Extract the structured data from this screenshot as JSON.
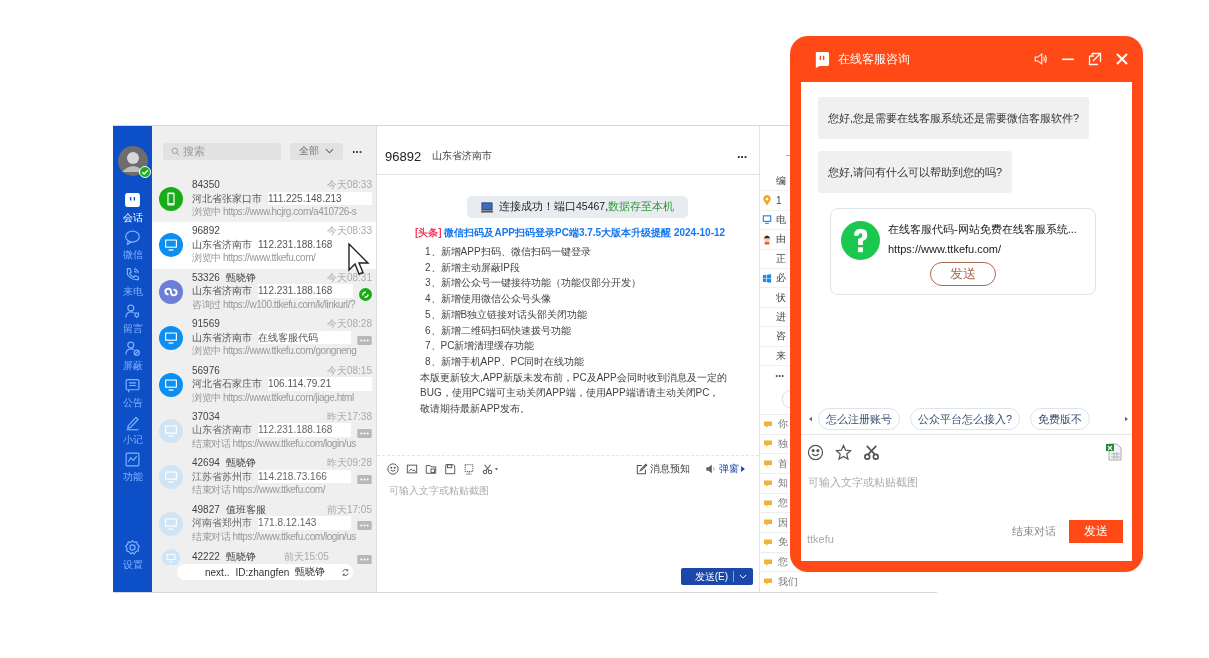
{
  "sidebar": {
    "online": true,
    "nav": [
      {
        "label": "会话",
        "selected": true
      },
      {
        "label": "微信",
        "selected": false
      },
      {
        "label": "来电",
        "selected": false
      },
      {
        "label": "留言",
        "selected": false
      },
      {
        "label": "屏蔽",
        "selected": false
      },
      {
        "label": "公告",
        "selected": false
      },
      {
        "label": "小记",
        "selected": false
      },
      {
        "label": "功能",
        "selected": false
      }
    ],
    "settings": "设置"
  },
  "list": {
    "search": {
      "placeholder": "搜索"
    },
    "filter": "全部",
    "more": "···"
  },
  "conversations": [
    {
      "id": "84350",
      "time": "今天08:33",
      "location": "河北省张家口市",
      "info": "111.225.148.213",
      "detail": "浏览中 https://www.hcjrg.com/a410726-s",
      "kind": "phone",
      "ended": false,
      "selected": false,
      "wechat": false,
      "menu": false
    },
    {
      "id": "96892",
      "time": "今天08:33",
      "location": "山东省济南市",
      "info": "112.231.188.168",
      "detail": "浏览中 https://www.ttkefu.com/",
      "kind": "monitor",
      "ended": false,
      "selected": true,
      "wechat": false,
      "menu": false
    },
    {
      "id": "53326",
      "name": "甄晓铮",
      "time": "今天08:31",
      "location": "山东省济南市",
      "info": "112.231.188.168",
      "detail": "咨询过 https://w100.ttkefu.com/k/linkurl/?",
      "kind": "miniapp",
      "ended": false,
      "selected": false,
      "wechat": true,
      "menu": false
    },
    {
      "id": "91569",
      "time": "今天08:28",
      "location": "山东省济南市",
      "info": "在线客服代码",
      "detail": "浏览中 https://www.ttkefu.com/gongneng",
      "kind": "monitor",
      "ended": false,
      "selected": false,
      "wechat": false,
      "menu": true
    },
    {
      "id": "56976",
      "time": "今天08:15",
      "location": "河北省石家庄市",
      "info": "106.114.79.21",
      "detail": "浏览中 https://www.ttkefu.com/jiage.html",
      "kind": "monitor",
      "ended": false,
      "selected": false,
      "wechat": false,
      "menu": false
    },
    {
      "id": "37034",
      "time": "昨天17:38",
      "location": "山东省济南市",
      "info": "112.231.188.168",
      "detail": "结束对话 https://www.ttkefu.com/login/us",
      "kind": "monitor",
      "ended": true,
      "selected": false,
      "wechat": false,
      "menu": true
    },
    {
      "id": "42694",
      "name": "甄晓铮",
      "time": "昨天09:28",
      "location": "江苏省苏州市",
      "info": "114.218.73.166",
      "detail": "结束对话 https://www.ttkefu.com/",
      "kind": "monitor",
      "ended": true,
      "selected": false,
      "wechat": false,
      "menu": true
    },
    {
      "id": "49827",
      "name": "值班客服",
      "time": "前天17:05",
      "location": "河南省郑州市",
      "info": "171.8.12.143",
      "detail": "结束对话 https://www.ttkefu.com/login/us",
      "kind": "monitor",
      "ended": true,
      "selected": false,
      "wechat": false,
      "menu": true
    },
    {
      "id": "42222",
      "name": "甄晓铮",
      "time": "前天15:05",
      "kind": "monitor",
      "ended": true,
      "selected": false,
      "wechat": false,
      "menu": true
    }
  ],
  "agent_pill": {
    "text": "next..",
    "id": "ID:zhangfen",
    "name": "甄晓铮"
  },
  "chat": {
    "visitor_id": "96892",
    "location": "山东省济南市",
    "more": "···",
    "banner": {
      "text": "连接成功！端口45467,",
      "highlight": "数据存至本机"
    },
    "headline": {
      "tag": "[头条]",
      "title": "微信扫码及APP扫码登录PC端3.7.5大版本升级提醒 2024-10-12"
    },
    "items": [
      "1、新增APP扫码、微信扫码一键登录",
      "2、新增主动屏蔽IP段",
      "3、新增公众号一键接待功能（功能仅部分开发）",
      "4、新增使用微信公众号头像",
      "5、新增B独立链接对话头部关闭功能",
      "6、新增二维码扫码快速拨号功能",
      "7、PC新增清理缓存功能",
      "8、新增手机APP、PC同时在线功能"
    ],
    "note": [
      "本版更新较大,APP新版未发布前，PC及APP会同时收到消息及一定的",
      "BUG，使用PC端可主动关闭APP端，使用APP端请请主动关闭PC，",
      "敬请期待最新APP发布。"
    ],
    "preview": "消息预知",
    "popup": "弹窗",
    "input": {
      "placeholder": "可输入文字或粘贴截图"
    },
    "send": "发送(E)"
  },
  "info_panel": {
    "rows": [
      {
        "text": "编",
        "kind": "text"
      },
      {
        "text": "1",
        "kind": "pin"
      },
      {
        "text": "电",
        "kind": "monitor"
      },
      {
        "text": "由",
        "kind": "person"
      },
      {
        "text": "正",
        "kind": "text"
      },
      {
        "text": "必",
        "kind": "windows"
      },
      {
        "text": "状",
        "kind": "text"
      },
      {
        "text": "进",
        "kind": "text"
      },
      {
        "text": "咨",
        "kind": "text"
      },
      {
        "text": "来",
        "kind": "text"
      }
    ],
    "more": "···",
    "messages": [
      "你",
      "独",
      "首",
      "知",
      "您",
      "因",
      "免",
      "您",
      "我们"
    ]
  },
  "widget": {
    "title": "在线客服咨询",
    "messages": [
      "您好,您是需要在线客服系统还是需要微信客服软件?",
      "您好,请问有什么可以帮助到您的吗?"
    ],
    "card": {
      "title": "在线客服代码-网站免费在线客服系统...",
      "url": "https://www.ttkefu.com/",
      "button": "发送"
    },
    "quick_replies": [
      "怎么注册账号",
      "公众平台怎么接入?",
      "免费版不"
    ],
    "input": {
      "placeholder": "可输入文字或粘贴截图"
    },
    "brand": "ttkefu",
    "end": "结束对话",
    "send": "发送"
  }
}
